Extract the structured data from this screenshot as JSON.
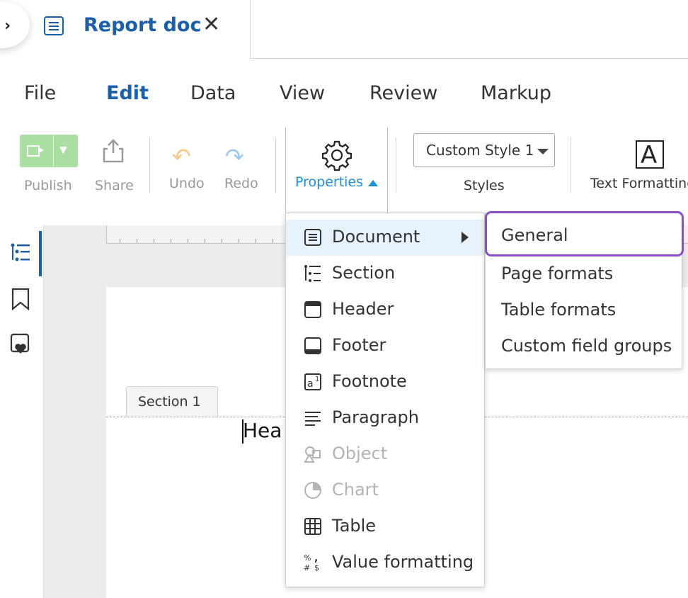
{
  "tab": {
    "title": "Report doc",
    "expand_icon": "chevron-right-icon",
    "doc_icon": "document-icon",
    "close_icon": "close-icon",
    "close_glyph": "✕",
    "expand_glyph": "›"
  },
  "menubar": {
    "items": [
      "File",
      "Edit",
      "Data",
      "View",
      "Review",
      "Markup"
    ],
    "active": "Edit"
  },
  "ribbon": {
    "publish_label": "Publish",
    "share_label": "Share",
    "undo_label": "Undo",
    "redo_label": "Redo",
    "properties_label": "Properties",
    "style_value": "Custom Style 1",
    "styles_label": "Styles",
    "text_formatting_label": "Text Formatting",
    "text_formatting_glyph": "A",
    "publish_color": "#a9dfa0",
    "accent_color": "#1a8fdc"
  },
  "rail": {
    "icons": [
      "outline-icon",
      "bookmark-icon",
      "favorite-icon"
    ]
  },
  "document": {
    "section_tab": "Section 1",
    "body_text": "Hea"
  },
  "properties_menu": {
    "items": [
      {
        "label": "Document",
        "icon": "document-icon",
        "has_submenu": true,
        "hovered": true,
        "disabled": false
      },
      {
        "label": "Section",
        "icon": "section-icon",
        "disabled": false
      },
      {
        "label": "Header",
        "icon": "header-icon",
        "disabled": false
      },
      {
        "label": "Footer",
        "icon": "footer-icon",
        "disabled": false
      },
      {
        "label": "Footnote",
        "icon": "footnote-icon",
        "disabled": false
      },
      {
        "label": "Paragraph",
        "icon": "paragraph-icon",
        "disabled": false
      },
      {
        "label": "Object",
        "icon": "object-icon",
        "disabled": true
      },
      {
        "label": "Chart",
        "icon": "chart-icon",
        "disabled": true
      },
      {
        "label": "Table",
        "icon": "table-icon",
        "disabled": false
      },
      {
        "label": "Value formatting",
        "icon": "value-formatting-icon",
        "disabled": false
      }
    ]
  },
  "document_submenu": {
    "items": [
      "General",
      "Page formats",
      "Table formats",
      "Custom field groups"
    ],
    "highlighted": "General",
    "highlight_color": "#8a4fc4"
  }
}
